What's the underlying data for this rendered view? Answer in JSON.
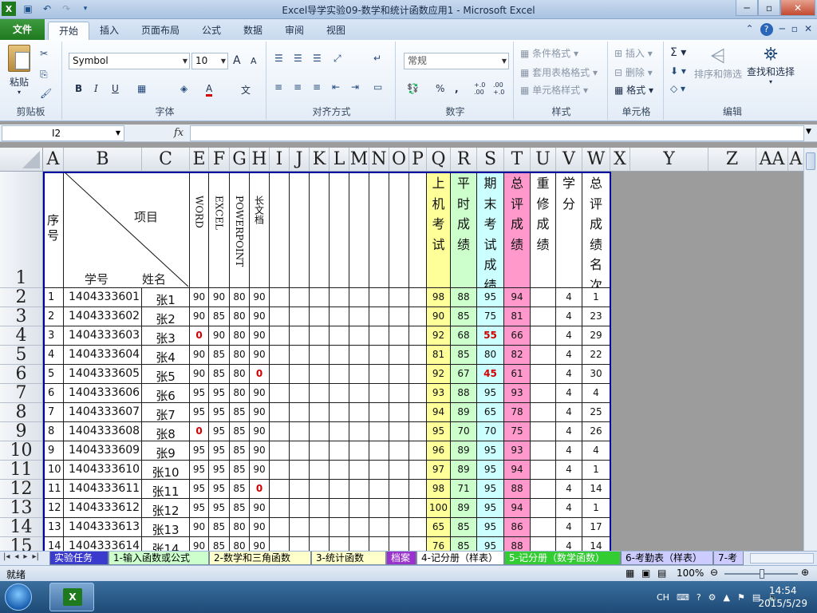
{
  "window": {
    "title": "Excel导学实验09-数学和统计函数应用1  -  Microsoft Excel",
    "controls": {
      "minimize": "─",
      "restore": "▫",
      "close": "✕"
    }
  },
  "ribbon_tabs": [
    "文件",
    "开始",
    "插入",
    "页面布局",
    "公式",
    "数据",
    "审阅",
    "视图"
  ],
  "ribbon": {
    "clipboard": {
      "label": "剪贴板",
      "paste": "粘贴"
    },
    "font": {
      "label": "字体",
      "font_name": "Symbol",
      "font_size": "10",
      "bold": "B",
      "italic": "I",
      "underline": "U",
      "grow": "A",
      "shrink": "A",
      "font_color": "A",
      "phonetic": "文"
    },
    "alignment": {
      "label": "对齐方式"
    },
    "number": {
      "label": "数字",
      "format": "常规",
      "percent": "%",
      "comma": ",",
      "inc_decimal": "+.0 .00",
      "dec_decimal": ".00 +.0"
    },
    "styles": {
      "label": "样式",
      "conditional": "条件格式",
      "table": "套用表格格式",
      "cell": "单元格样式"
    },
    "cells": {
      "label": "单元格",
      "insert": "插入",
      "delete": "删除",
      "format": "格式"
    },
    "editing": {
      "label": "编辑",
      "sort": "排序和筛选",
      "find": "查找和选择"
    }
  },
  "formula_bar": {
    "name_box": "I2",
    "fx": "fx",
    "value": ""
  },
  "columns": [
    "A",
    "B",
    "C",
    "E",
    "F",
    "G",
    "H",
    "I",
    "J",
    "K",
    "L",
    "M",
    "N",
    "O",
    "P",
    "Q",
    "R",
    "S",
    "T",
    "U",
    "V",
    "W",
    "X",
    "Y",
    "Z",
    "AA",
    "A"
  ],
  "header_row": {
    "row_no": "1",
    "seq": "序号",
    "item": "项目",
    "student_id": "学号",
    "name": "姓名",
    "word": "WORD",
    "excel": "EXCEL",
    "ppt": "POWERPOINT",
    "long_doc": "长文档",
    "q_chars": "上机考试",
    "r_chars": "平时成绩",
    "s_chars": "期末考试成绩",
    "t_chars": "总评成绩",
    "u_chars": "重修成绩",
    "v_chars": "学分",
    "w_chars": "总评成绩名次"
  },
  "rows": [
    {
      "row": "2",
      "seq": "1",
      "id": "1404333601",
      "name": "张1",
      "e": "90",
      "f": "90",
      "g": "80",
      "h": "90",
      "q": "98",
      "r": "88",
      "s": "95",
      "t": "94",
      "v": "4",
      "w": "1"
    },
    {
      "row": "3",
      "seq": "2",
      "id": "1404333602",
      "name": "张2",
      "e": "90",
      "f": "85",
      "g": "80",
      "h": "90",
      "q": "90",
      "r": "85",
      "s": "75",
      "t": "81",
      "v": "4",
      "w": "23"
    },
    {
      "row": "4",
      "seq": "3",
      "id": "1404333603",
      "name": "张3",
      "e": "0",
      "f": "90",
      "g": "80",
      "h": "90",
      "q": "92",
      "r": "68",
      "s": "55",
      "t": "66",
      "v": "4",
      "w": "29"
    },
    {
      "row": "5",
      "seq": "4",
      "id": "1404333604",
      "name": "张4",
      "e": "90",
      "f": "85",
      "g": "80",
      "h": "90",
      "q": "81",
      "r": "85",
      "s": "80",
      "t": "82",
      "v": "4",
      "w": "22"
    },
    {
      "row": "6",
      "seq": "5",
      "id": "1404333605",
      "name": "张5",
      "e": "90",
      "f": "85",
      "g": "80",
      "h": "0",
      "q": "92",
      "r": "67",
      "s": "45",
      "t": "61",
      "v": "4",
      "w": "30"
    },
    {
      "row": "7",
      "seq": "6",
      "id": "1404333606",
      "name": "张6",
      "e": "95",
      "f": "95",
      "g": "80",
      "h": "90",
      "q": "93",
      "r": "88",
      "s": "95",
      "t": "93",
      "v": "4",
      "w": "4"
    },
    {
      "row": "8",
      "seq": "7",
      "id": "1404333607",
      "name": "张7",
      "e": "95",
      "f": "95",
      "g": "85",
      "h": "90",
      "q": "94",
      "r": "89",
      "s": "65",
      "t": "78",
      "v": "4",
      "w": "25"
    },
    {
      "row": "9",
      "seq": "8",
      "id": "1404333608",
      "name": "张8",
      "e": "0",
      "f": "95",
      "g": "85",
      "h": "90",
      "q": "95",
      "r": "70",
      "s": "70",
      "t": "75",
      "v": "4",
      "w": "26"
    },
    {
      "row": "10",
      "seq": "9",
      "id": "1404333609",
      "name": "张9",
      "e": "95",
      "f": "95",
      "g": "85",
      "h": "90",
      "q": "96",
      "r": "89",
      "s": "95",
      "t": "93",
      "v": "4",
      "w": "4"
    },
    {
      "row": "11",
      "seq": "10",
      "id": "1404333610",
      "name": "张10",
      "e": "95",
      "f": "95",
      "g": "85",
      "h": "90",
      "q": "97",
      "r": "89",
      "s": "95",
      "t": "94",
      "v": "4",
      "w": "1"
    },
    {
      "row": "12",
      "seq": "11",
      "id": "1404333611",
      "name": "张11",
      "e": "95",
      "f": "95",
      "g": "85",
      "h": "0",
      "q": "98",
      "r": "71",
      "s": "95",
      "t": "88",
      "v": "4",
      "w": "14"
    },
    {
      "row": "13",
      "seq": "12",
      "id": "1404333612",
      "name": "张12",
      "e": "95",
      "f": "95",
      "g": "85",
      "h": "90",
      "q": "100",
      "r": "89",
      "s": "95",
      "t": "94",
      "v": "4",
      "w": "1"
    },
    {
      "row": "14",
      "seq": "13",
      "id": "1404333613",
      "name": "张13",
      "e": "90",
      "f": "85",
      "g": "80",
      "h": "90",
      "q": "65",
      "r": "85",
      "s": "95",
      "t": "86",
      "v": "4",
      "w": "17"
    },
    {
      "row": "15",
      "seq": "14",
      "id": "1404333614",
      "name": "张14",
      "e": "90",
      "f": "85",
      "g": "80",
      "h": "90",
      "q": "76",
      "r": "85",
      "s": "95",
      "t": "88",
      "v": "4",
      "w": "14"
    }
  ],
  "sheet_tabs": [
    "实验任务",
    "1-输入函数或公式",
    "2-数学和三角函数",
    "3-统计函数",
    "档案",
    "4-记分册（样表）",
    "5-记分册（数学函数）",
    "6-考勤表（样表）",
    "7-考"
  ],
  "status": {
    "ready": "就绪",
    "zoom": "100%"
  },
  "taskbar": {
    "ime": "CH",
    "time": "14:54",
    "date": "2015/5/29"
  },
  "colors": {
    "q_fill": "#ffff99",
    "r_fill": "#ccffcc",
    "s_fill": "#ccffff",
    "t_fill": "#ff99cc",
    "red": "#d00000",
    "accent": "#1f7a1f"
  }
}
